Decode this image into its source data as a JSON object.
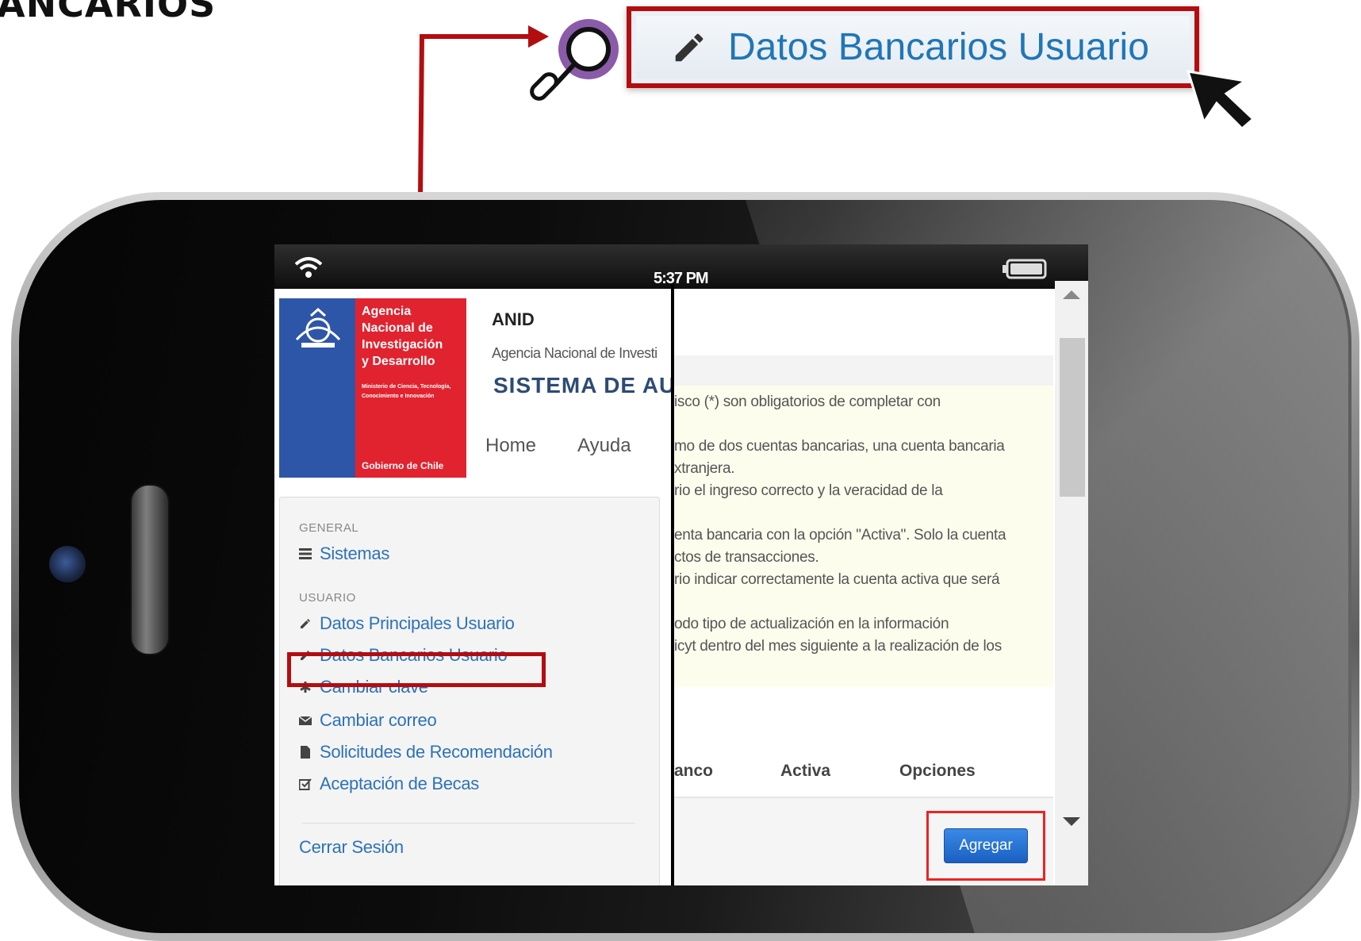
{
  "page": {
    "heading_fragment": "ANCARIOS"
  },
  "callout": {
    "label": "Datos Bancarios Usuario",
    "icon": "pencil-icon"
  },
  "status_bar": {
    "time": "5:37 PM"
  },
  "header": {
    "logo_lines": [
      "Agencia",
      "Nacional de",
      "Investigación",
      "y Desarrollo"
    ],
    "logo_ministry": "Ministerio de Ciencia, Tecnología, Conocimiento e Innovación",
    "logo_gobierno": "Gobierno de Chile",
    "org_short": "ANID",
    "org_full": "Agencia Nacional de Investi",
    "system_title": "SISTEMA DE AUT",
    "nav": [
      "Home",
      "Ayuda"
    ]
  },
  "sidebar": {
    "general_label": "GENERAL",
    "general_items": [
      {
        "label": "Sistemas",
        "icon": "list-icon"
      }
    ],
    "usuario_label": "USUARIO",
    "usuario_items": [
      {
        "label": "Datos Principales Usuario",
        "icon": "pencil-icon"
      },
      {
        "label": "Datos Bancarios Usuario",
        "icon": "pencil-icon"
      },
      {
        "label": "Cambiar clave",
        "icon": "asterisk-icon"
      },
      {
        "label": "Cambiar correo",
        "icon": "envelope-icon"
      },
      {
        "label": "Solicitudes de Recomendación",
        "icon": "file-icon"
      },
      {
        "label": "Aceptación de Becas",
        "icon": "checkbox-edit-icon"
      }
    ],
    "logout": "Cerrar Sesión"
  },
  "info": {
    "lines": [
      "isco (*) son obligatorios de completar con",
      "mo de dos cuentas bancarias, una cuenta bancaria",
      "xtranjera.",
      "rio el ingreso correcto y la veracidad de la",
      "enta bancaria con la opción \"Activa\". Solo la cuenta",
      "ctos de transacciones.",
      "rio indicar correctamente la cuenta activa que será",
      "odo tipo de actualización en la información",
      "icyt dentro del mes siguiente a la realización de los"
    ]
  },
  "table": {
    "headers": [
      "anco",
      "Activa",
      "Opciones"
    ]
  },
  "actions": {
    "add_label": "Agregar"
  },
  "colors": {
    "annotation_red": "#b40d10",
    "link_blue": "#2d72b8",
    "brand_blue": "#2e56a8",
    "brand_red": "#e1232f",
    "magnifier_purple": "#8a5ba8"
  }
}
